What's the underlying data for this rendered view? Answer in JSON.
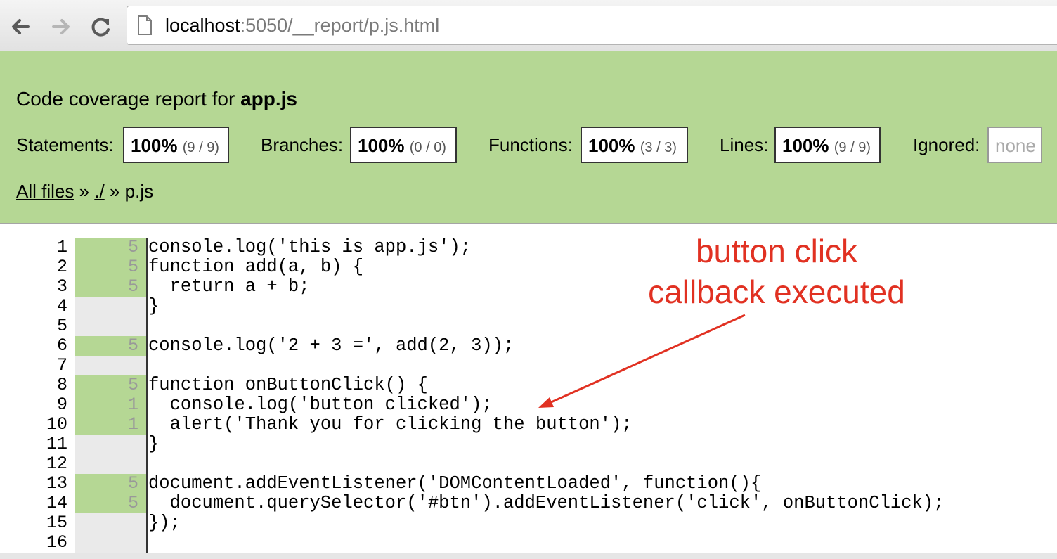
{
  "browser": {
    "url_host": "localhost",
    "url_path": ":5050/__report/p.js.html"
  },
  "report": {
    "title_prefix": "Code coverage report for ",
    "title_file": "app.js",
    "stats": {
      "statements": {
        "label": "Statements:",
        "pct": "100%",
        "frac": "(9 / 9)"
      },
      "branches": {
        "label": "Branches:",
        "pct": "100%",
        "frac": "(0 / 0)"
      },
      "functions": {
        "label": "Functions:",
        "pct": "100%",
        "frac": "(3 / 3)"
      },
      "lines": {
        "label": "Lines:",
        "pct": "100%",
        "frac": "(9 / 9)"
      },
      "ignored": {
        "label": "Ignored:",
        "value": "none"
      }
    },
    "breadcrumb": {
      "all_files": "All files",
      "sep1": " » ",
      "dir": "./",
      "sep2": " » ",
      "file": "p.js"
    }
  },
  "code": {
    "lines": [
      {
        "n": "1",
        "hits": "5",
        "covered": true,
        "text": "console.log('this is app.js');"
      },
      {
        "n": "2",
        "hits": "5",
        "covered": true,
        "text": "function add(a, b) {"
      },
      {
        "n": "3",
        "hits": "5",
        "covered": true,
        "text": "  return a + b;"
      },
      {
        "n": "4",
        "hits": "",
        "covered": false,
        "text": "}"
      },
      {
        "n": "5",
        "hits": "",
        "covered": false,
        "text": ""
      },
      {
        "n": "6",
        "hits": "5",
        "covered": true,
        "text": "console.log('2 + 3 =', add(2, 3));"
      },
      {
        "n": "7",
        "hits": "",
        "covered": false,
        "text": ""
      },
      {
        "n": "8",
        "hits": "5",
        "covered": true,
        "text": "function onButtonClick() {"
      },
      {
        "n": "9",
        "hits": "1",
        "covered": true,
        "text": "  console.log('button clicked');"
      },
      {
        "n": "10",
        "hits": "1",
        "covered": true,
        "text": "  alert('Thank you for clicking the button');"
      },
      {
        "n": "11",
        "hits": "",
        "covered": false,
        "text": "}"
      },
      {
        "n": "12",
        "hits": "",
        "covered": false,
        "text": ""
      },
      {
        "n": "13",
        "hits": "5",
        "covered": true,
        "text": "document.addEventListener('DOMContentLoaded', function(){"
      },
      {
        "n": "14",
        "hits": "5",
        "covered": true,
        "text": "  document.querySelector('#btn').addEventListener('click', onButtonClick);"
      },
      {
        "n": "15",
        "hits": "",
        "covered": false,
        "text": "});"
      },
      {
        "n": "16",
        "hits": "",
        "covered": false,
        "text": ""
      }
    ]
  },
  "annotation": {
    "line1": "button click",
    "line2": "callback executed",
    "color": "#e13122"
  },
  "icons": [
    "back-arrow-icon",
    "forward-arrow-icon",
    "reload-icon",
    "page-icon"
  ]
}
